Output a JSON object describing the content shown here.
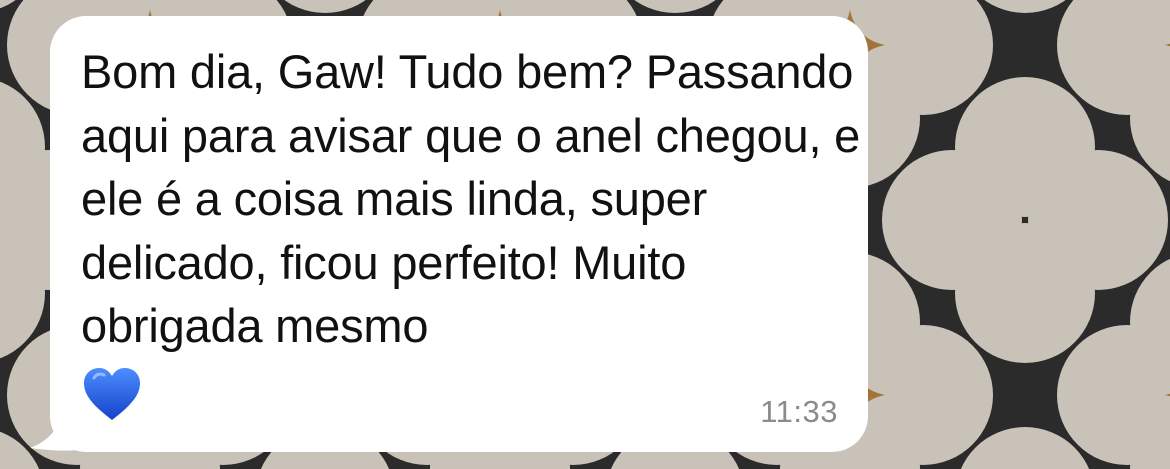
{
  "chat": {
    "message": {
      "text": "Bom dia, Gaw! Tudo bem? Passando aqui para avisar que o anel chegou, e ele é a coisa mais linda, super delicado, ficou perfeito! Muito obrigada mesmo",
      "emoji": "blue-heart",
      "time": "11:33",
      "direction": "incoming"
    }
  },
  "colors": {
    "wallpaper_dark": "#2b2b2b",
    "wallpaper_petal": "#c9c2b8",
    "wallpaper_star": "#a3733a",
    "bubble": "#ffffff",
    "text": "#111111",
    "timestamp": "#8a8a8f",
    "heart": "#1f5fe8"
  }
}
